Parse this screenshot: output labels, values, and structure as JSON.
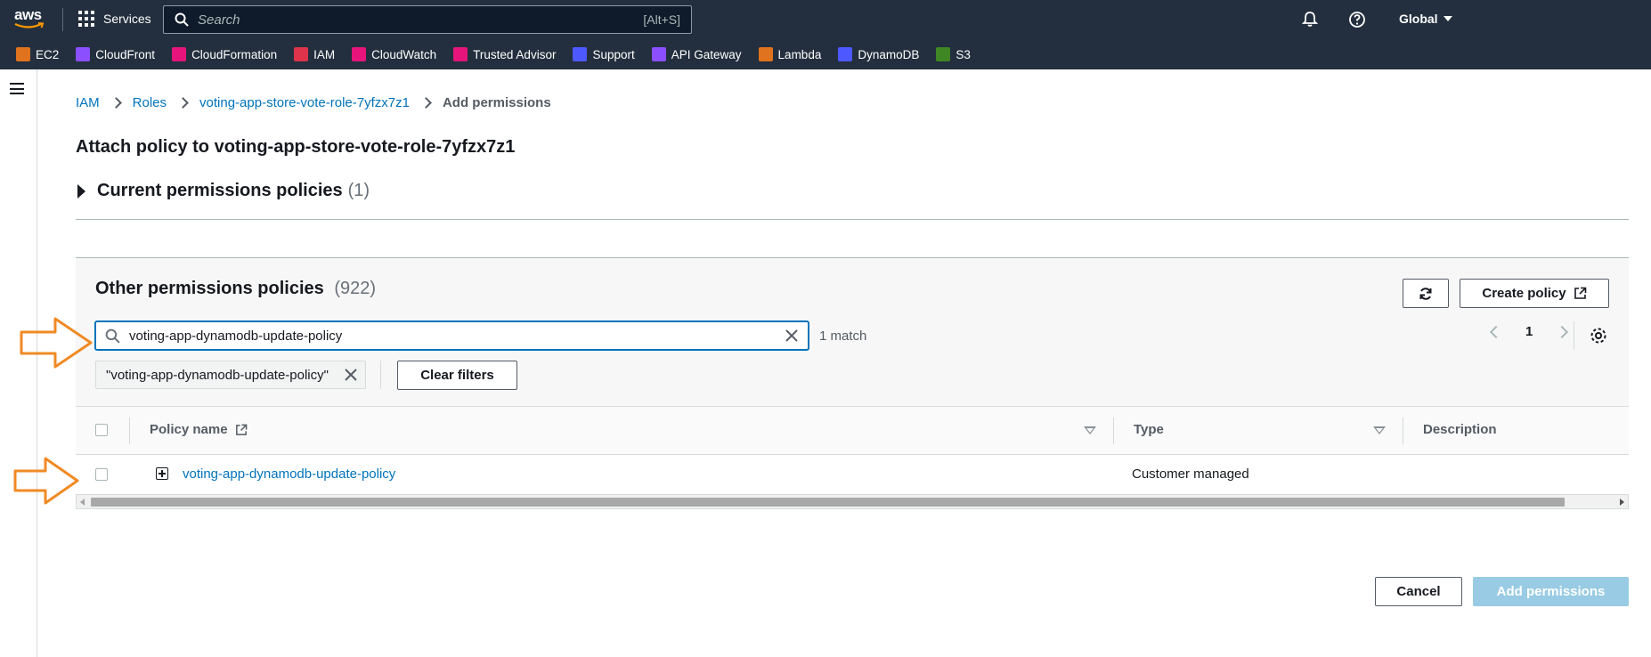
{
  "topnav": {
    "services_label": "Services",
    "search_placeholder": "Search",
    "search_shortcut": "[Alt+S]",
    "region_label": "Global"
  },
  "favorites": [
    {
      "label": "EC2",
      "color": "#e0731d",
      "icon": "ec2-icon"
    },
    {
      "label": "CloudFront",
      "color": "#8c4fff",
      "icon": "cloudfront-icon"
    },
    {
      "label": "CloudFormation",
      "color": "#e7157b",
      "icon": "cloudformation-icon"
    },
    {
      "label": "IAM",
      "color": "#dd344c",
      "icon": "iam-icon"
    },
    {
      "label": "CloudWatch",
      "color": "#e7157b",
      "icon": "cloudwatch-icon"
    },
    {
      "label": "Trusted Advisor",
      "color": "#e7157b",
      "icon": "trusted-advisor-icon"
    },
    {
      "label": "Support",
      "color": "#4d59ff",
      "icon": "support-icon"
    },
    {
      "label": "API Gateway",
      "color": "#8c4fff",
      "icon": "api-gateway-icon"
    },
    {
      "label": "Lambda",
      "color": "#e0731d",
      "icon": "lambda-icon"
    },
    {
      "label": "DynamoDB",
      "color": "#4d59ff",
      "icon": "dynamodb-icon"
    },
    {
      "label": "S3",
      "color": "#3f8624",
      "icon": "s3-icon"
    }
  ],
  "breadcrumb": {
    "items": [
      "IAM",
      "Roles",
      "voting-app-store-vote-role-7yfzx7z1"
    ],
    "current": "Add permissions"
  },
  "page": {
    "title": "Attach policy to voting-app-store-vote-role-7yfzx7z1",
    "current_policies_label": "Current permissions policies",
    "current_policies_count": "(1)"
  },
  "panel": {
    "title": "Other permissions policies",
    "count": "(922)",
    "create_policy_label": "Create policy",
    "filter_value": "voting-app-dynamodb-update-policy",
    "match_count": "1 match",
    "page_number": "1",
    "filter_token": "\"voting-app-dynamodb-update-policy\"",
    "clear_filters_label": "Clear filters"
  },
  "table": {
    "columns": [
      "Policy name",
      "Type",
      "Description"
    ],
    "rows": [
      {
        "policy_name": "voting-app-dynamodb-update-policy",
        "type": "Customer managed",
        "description": ""
      }
    ]
  },
  "footer": {
    "cancel_label": "Cancel",
    "add_label": "Add permissions"
  },
  "colors": {
    "accent": "#0073bb",
    "nav_bg": "#232f3e",
    "annotation_arrow": "#f08a24"
  }
}
